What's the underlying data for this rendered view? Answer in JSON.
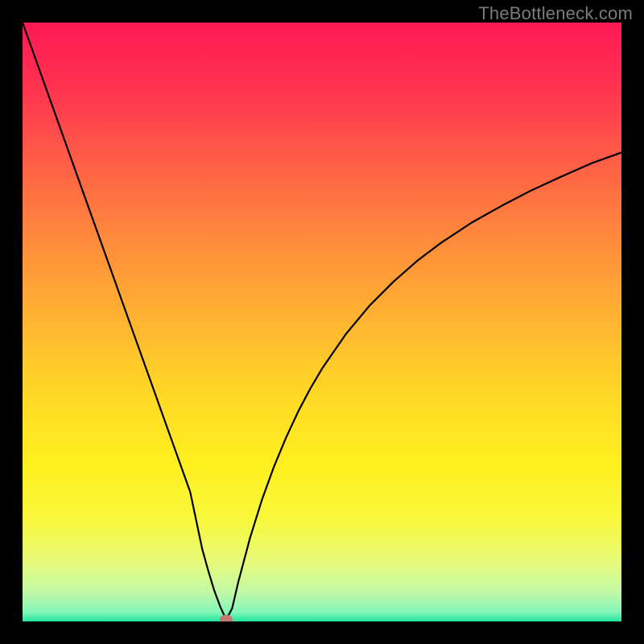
{
  "attribution": "TheBottleneck.com",
  "chart_data": {
    "type": "line",
    "title": "",
    "xlabel": "",
    "ylabel": "",
    "xlim": [
      0,
      100
    ],
    "ylim": [
      0,
      100
    ],
    "gradient_background": {
      "colors": [
        {
          "offset": 0.0,
          "hex": "#ff1a55"
        },
        {
          "offset": 0.1,
          "hex": "#ff3050"
        },
        {
          "offset": 0.22,
          "hex": "#ff5a47"
        },
        {
          "offset": 0.36,
          "hex": "#ff8a3c"
        },
        {
          "offset": 0.5,
          "hex": "#ffb531"
        },
        {
          "offset": 0.62,
          "hex": "#ffd826"
        },
        {
          "offset": 0.74,
          "hex": "#fff01f"
        },
        {
          "offset": 0.83,
          "hex": "#f8f83c"
        },
        {
          "offset": 0.9,
          "hex": "#e7fa79"
        },
        {
          "offset": 0.95,
          "hex": "#c3f9a6"
        },
        {
          "offset": 0.985,
          "hex": "#80f6b8"
        },
        {
          "offset": 1.0,
          "hex": "#22e59c"
        }
      ]
    },
    "series": [
      {
        "name": "curve",
        "color": "#000000",
        "stroke_width": 2.2,
        "x": [
          0,
          2,
          4,
          6,
          8,
          10,
          12,
          14,
          16,
          18,
          20,
          22,
          24,
          26,
          28,
          30,
          31,
          32,
          33,
          34,
          35,
          36,
          38,
          40,
          42,
          44,
          46,
          48,
          50,
          54,
          58,
          62,
          66,
          70,
          75,
          80,
          85,
          90,
          95,
          100
        ],
        "y": [
          100,
          94.4,
          88.8,
          83.2,
          77.6,
          72.0,
          66.4,
          60.8,
          55.2,
          49.6,
          44.0,
          38.4,
          32.8,
          27.2,
          21.6,
          12.1,
          8.5,
          5.2,
          2.5,
          0.3,
          2.2,
          6.5,
          14.0,
          20.4,
          25.9,
          30.7,
          35.0,
          38.8,
          42.2,
          48.0,
          52.8,
          56.8,
          60.3,
          63.3,
          66.6,
          69.4,
          72.0,
          74.3,
          76.5,
          78.3
        ]
      }
    ],
    "marker": {
      "name": "optimum-dot",
      "x": 34,
      "y": 0,
      "color": "#c47a6e",
      "rx": 8,
      "ry": 6
    }
  }
}
